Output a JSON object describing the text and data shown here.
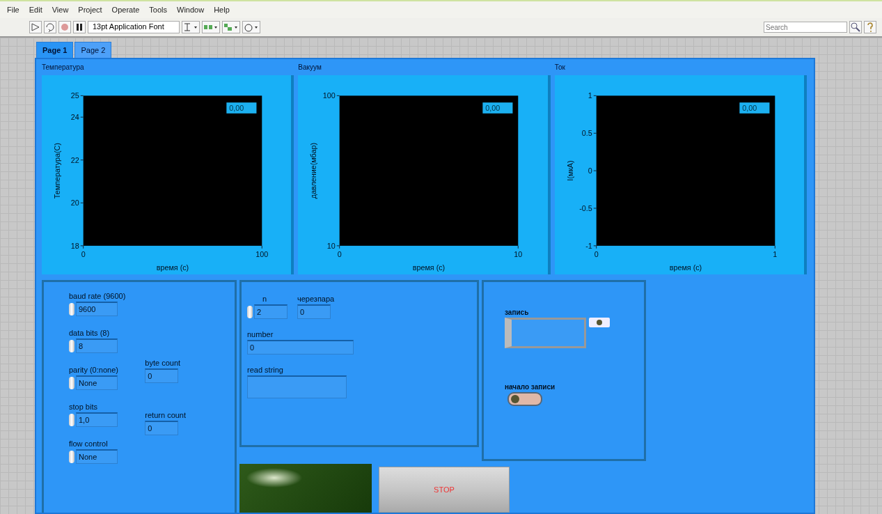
{
  "menu": [
    "File",
    "Edit",
    "View",
    "Project",
    "Operate",
    "Tools",
    "Window",
    "Help"
  ],
  "toolbar": {
    "font": "13pt Application Font",
    "search": {
      "placeholder": "Search"
    }
  },
  "tabs": [
    {
      "label": "Page 1",
      "selected": true
    },
    {
      "label": "Page 2",
      "selected": false
    }
  ],
  "charts": [
    {
      "title": "Температура",
      "legend": "0,00",
      "chart_data": {
        "type": "line",
        "xlabel": "время (с)",
        "ylabel": "Температура(С)",
        "xlim": [
          0,
          100
        ],
        "ylim": [
          18,
          25
        ],
        "xticks": [
          0,
          100
        ],
        "yticks": [
          18,
          20,
          22,
          24,
          25
        ]
      }
    },
    {
      "title": "Вакуум",
      "legend": "0,00",
      "chart_data": {
        "type": "line",
        "xlabel": "время (с)",
        "ylabel": "давление(мбар)",
        "xlim": [
          0,
          10
        ],
        "ylim": [
          10,
          100
        ],
        "xticks": [
          0,
          {
            "value": 10,
            "label": "10"
          }
        ],
        "yticks": [
          10,
          100
        ]
      }
    },
    {
      "title": "Ток",
      "legend": "0,00",
      "chart_data": {
        "type": "line",
        "xlabel": "время (с)",
        "ylabel": "I(мкА)",
        "xlim": [
          0,
          1
        ],
        "ylim": [
          -1,
          1
        ],
        "xticks": [
          0,
          1
        ],
        "yticks": [
          -1,
          -0.5,
          0,
          0.5,
          1
        ]
      }
    }
  ],
  "serial": {
    "settings": [
      {
        "label": "baud rate (9600)",
        "value": "9600"
      },
      {
        "label": "data bits (8)",
        "value": "8"
      },
      {
        "label": "parity (0:none)",
        "value": "None"
      },
      {
        "label": "stop bits",
        "value": "1,0"
      },
      {
        "label": "flow control",
        "value": "None"
      }
    ],
    "counts": [
      {
        "label": "byte count",
        "value": "0"
      },
      {
        "label": "return count",
        "value": "0"
      }
    ]
  },
  "reader": {
    "n": {
      "label": "n",
      "value": "2"
    },
    "skip": {
      "label": "черезпара",
      "value": "0"
    },
    "number": {
      "label": "number",
      "value": "0"
    },
    "read_string": {
      "label": "read string"
    }
  },
  "recording": {
    "path_label": "запись",
    "toggle_label": "начало записи",
    "toggle_on": false
  },
  "led": {
    "on": false
  },
  "stop_button": "STOP"
}
